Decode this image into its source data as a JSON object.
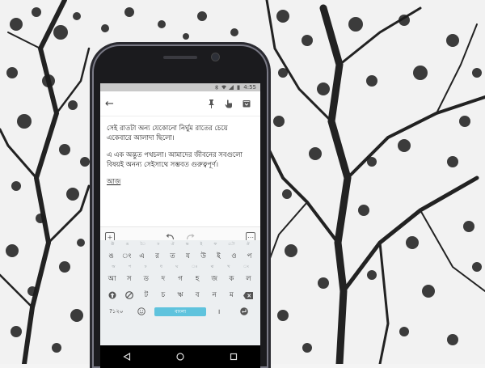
{
  "status_bar": {
    "time": "4:55",
    "icons": [
      "bluetooth-icon",
      "wifi-icon",
      "signal-icon",
      "battery-icon"
    ]
  },
  "toolbar": {
    "icons": [
      "back-arrow-icon",
      "pin-icon",
      "reminder-hand-icon",
      "archive-icon"
    ]
  },
  "note": {
    "paragraph_1": "সেই রাতটা অন্য যেকোনো নির্ঘুম রাতের চেয়ে একেবারে আলাদা ছিলো।",
    "paragraph_2": "এ এক অদ্ভুত পথচলা। আমাদের জীবনের সবগুলো বিষয়ই অনন্য সেইসাথে সম্ভবত গুরুত্বপূর্ণ।",
    "underlined_word": "আজ"
  },
  "editor_bar": {
    "icons": [
      "add-box-icon",
      "undo-icon",
      "redo-icon",
      "more-options-icon"
    ]
  },
  "keyboard": {
    "hint_row": [
      "ঊ",
      "ঙ",
      "ৈ",
      "ঢ",
      "ঐ",
      "ভ",
      "ই",
      "ফ",
      "ৌ",
      "ঔ"
    ],
    "row_1": [
      "ঙ",
      "ং",
      "এ",
      "র",
      "ত",
      "য",
      "উ",
      "ই",
      "ও",
      "প"
    ],
    "row_2": [
      "আ",
      "স",
      "ড",
      "দ",
      "গ",
      "হ",
      "জ",
      "ক",
      "ল"
    ],
    "row_3": [
      "ট",
      "চ",
      "ঋ",
      "ব",
      "ন",
      "ম"
    ],
    "symbols_key": "?১২০",
    "space_label": "বাংলা",
    "icons": [
      "shift-icon",
      "no-entry-icon",
      "backspace-icon",
      "emoji-icon",
      "enter-icon"
    ]
  },
  "nav_bar": {
    "icons": [
      "back-triangle-icon",
      "home-circle-icon",
      "recents-square-icon"
    ]
  }
}
